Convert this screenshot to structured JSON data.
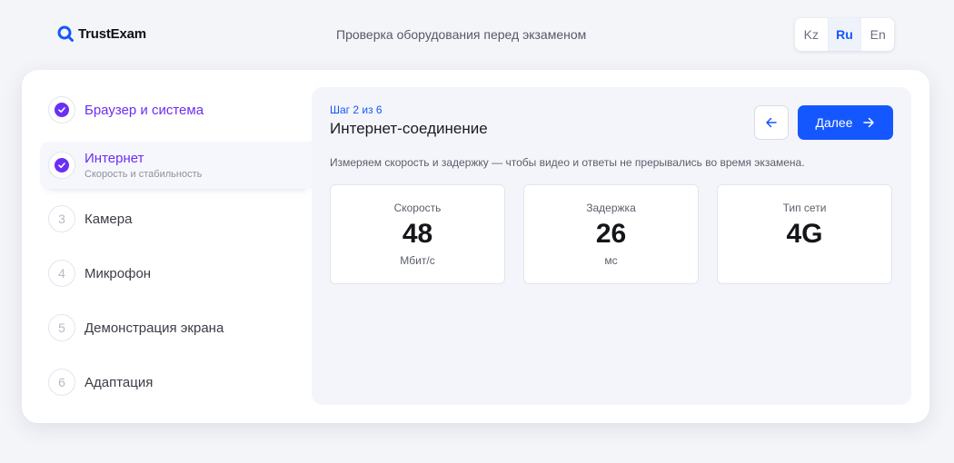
{
  "header": {
    "logo_text": "TrustExam",
    "subtitle": "Проверка оборудования перед экзаменом",
    "languages": [
      {
        "label": "Kz",
        "active": false
      },
      {
        "label": "Ru",
        "active": true
      },
      {
        "label": "En",
        "active": false
      }
    ]
  },
  "steps": [
    {
      "number": "1",
      "label": "Браузер и система",
      "hint": "",
      "status": "done"
    },
    {
      "number": "2",
      "label": "Интернет",
      "hint": "Скорость и стабильность",
      "status": "current"
    },
    {
      "number": "3",
      "label": "Камера",
      "hint": "",
      "status": "pending"
    },
    {
      "number": "4",
      "label": "Микрофон",
      "hint": "",
      "status": "pending"
    },
    {
      "number": "5",
      "label": "Демонстрация экрана",
      "hint": "",
      "status": "pending"
    },
    {
      "number": "6",
      "label": "Адаптация",
      "hint": "",
      "status": "pending"
    }
  ],
  "panel": {
    "step_counter": "Шаг 2 из 6",
    "title": "Интернет-соединение",
    "next_label": "Далее",
    "description": "Измеряем скорость и задержку — чтобы видео и ответы не прерывались во время экзамена.",
    "metrics": [
      {
        "label": "Скорость",
        "value": "48",
        "unit": "Мбит/с"
      },
      {
        "label": "Задержка",
        "value": "26",
        "unit": "мс"
      },
      {
        "label": "Тип сети",
        "value": "4G",
        "unit": ""
      }
    ]
  },
  "colors": {
    "accent": "#1557ff",
    "done": "#6a2ff5",
    "background": "#f4f5f9"
  }
}
